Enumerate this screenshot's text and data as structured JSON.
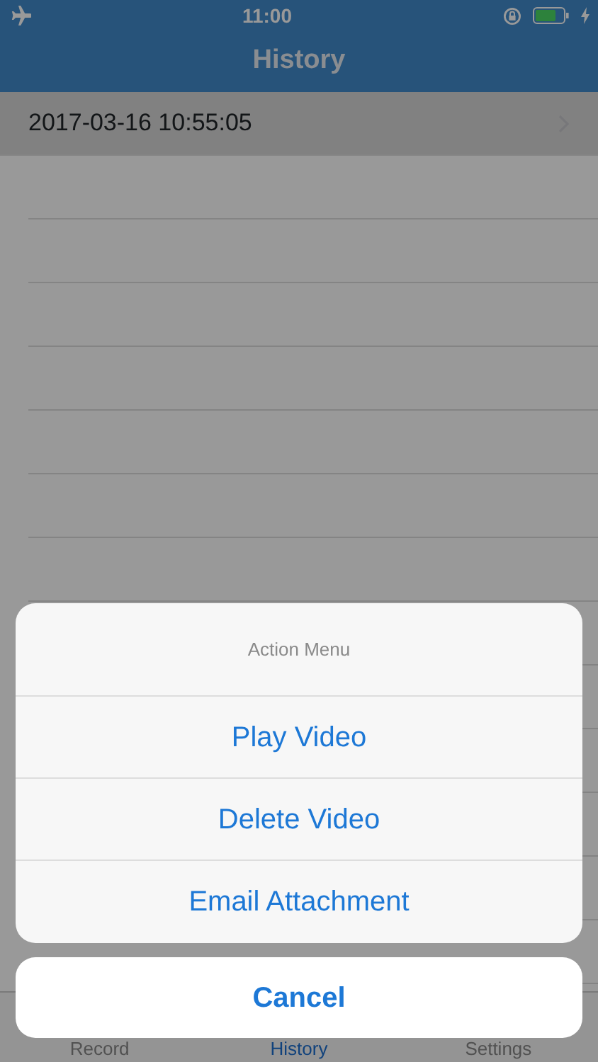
{
  "status_bar": {
    "time": "11:00"
  },
  "nav_bar": {
    "title": "History"
  },
  "history": [
    {
      "label": "2017-03-16 10:55:05",
      "selected": true
    }
  ],
  "tab_bar": [
    {
      "label": "Record",
      "selected": false
    },
    {
      "label": "History",
      "selected": true
    },
    {
      "label": "Settings",
      "selected": false
    }
  ],
  "action_sheet": {
    "title": "Action Menu",
    "actions": [
      "Play Video",
      "Delete Video",
      "Email Attachment"
    ],
    "cancel": "Cancel"
  }
}
